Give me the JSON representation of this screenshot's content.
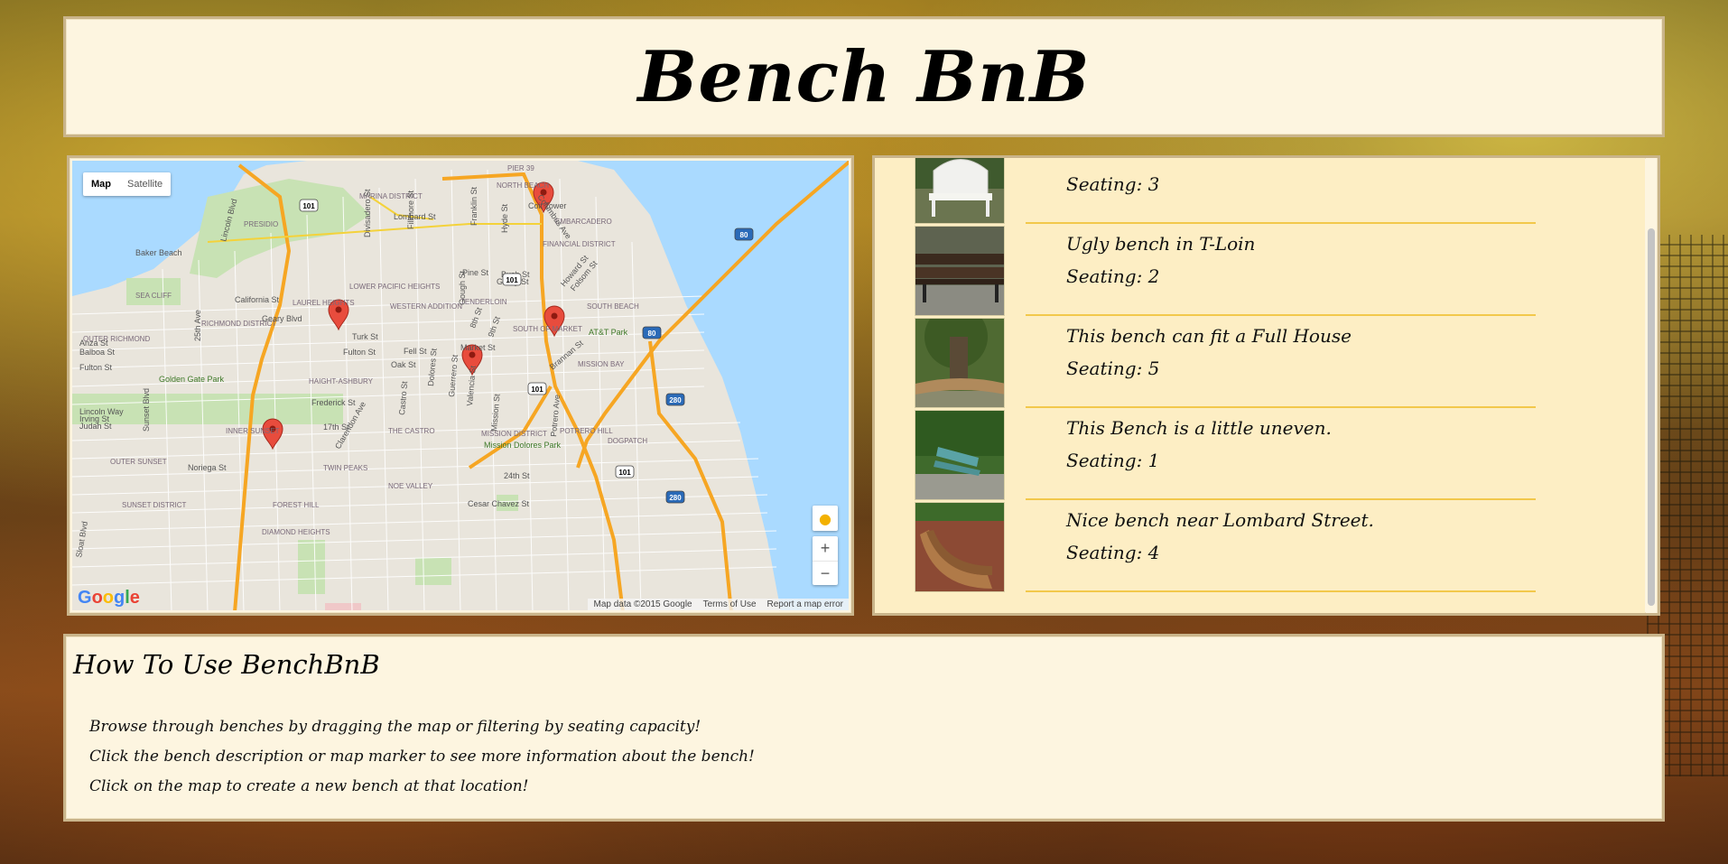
{
  "header": {
    "title": "Bench BnB"
  },
  "map": {
    "type_buttons": [
      {
        "label": "Map",
        "active": true
      },
      {
        "label": "Satellite",
        "active": false
      }
    ],
    "zoom_in": "+",
    "zoom_out": "−",
    "footer": {
      "attribution": "Map data ©2015 Google",
      "terms": "Terms of Use",
      "report": "Report a map error"
    },
    "logo": "Google",
    "place_labels": [
      "PIER 39",
      "NORTH BEACH",
      "MARINA DISTRICT",
      "Coit Tower",
      "Lombard St",
      "PRESIDIO",
      "EMBARCADERO",
      "FINANCIAL DISTRICT",
      "Baker Beach",
      "Pine St",
      "Bush St",
      "LOWER PACIFIC HEIGHTS",
      "California St",
      "LAUREL HEIGHTS",
      "SEA CLIFF",
      "TENDERLOIN",
      "SOUTH BEACH",
      "WESTERN ADDITION",
      "Turk St",
      "AT&T Park",
      "RICHMOND DISTRICT",
      "OUTER RICHMOND",
      "Geary Blvd",
      "Balboa St",
      "Fulton St",
      "Fell St",
      "Oak St",
      "SOUTH OF MARKET",
      "MISSION BAY",
      "Golden Gate Park",
      "HAIGHT-ASHBURY",
      "Lincoln Way",
      "Frederick St",
      "INNER SUNSET",
      "17th St",
      "THE CASTRO",
      "MISSION DISTRICT",
      "POTRERO HILL",
      "DOGPATCH",
      "Mission Dolores Park",
      "OUTER SUNSET",
      "Noriega St",
      "TWIN PEAKS",
      "NOE VALLEY",
      "24th St",
      "SUNSET DISTRICT",
      "FOREST HILL",
      "Cesar Chavez St",
      "DIAMOND HEIGHTS",
      "Judah St",
      "Irving St",
      "Anza St",
      "Fulton St",
      "Market St",
      "Divisadero St",
      "Fillmore St",
      "Franklin St",
      "Hyde St",
      "Gough St",
      "Columbus Ave",
      "Howard St",
      "Folsom St",
      "Brannan St",
      "Lincoln Blvd",
      "25th Ave",
      "Sunset Blvd",
      "Clarendon Ave",
      "Castro St",
      "Dolores St",
      "Guerrero St",
      "Valencia St",
      "Mission St",
      "Potrero Ave",
      "Sloat Blvd",
      "8th St",
      "9th St",
      "Geary St"
    ],
    "highway_shields": [
      "101",
      "101",
      "101",
      "80",
      "80",
      "280",
      "280",
      "101"
    ],
    "marker_count": 6
  },
  "benches": [
    {
      "title": "",
      "seating": "Seating: 3",
      "palette": "white-iron"
    },
    {
      "title": "Ugly bench in T-Loin",
      "seating": "Seating: 2",
      "palette": "dark-wood"
    },
    {
      "title": "This bench can fit a Full House",
      "seating": "Seating: 5",
      "palette": "tree-circle"
    },
    {
      "title": "This Bench is a little uneven.",
      "seating": "Seating: 1",
      "palette": "green-bench"
    },
    {
      "title": "Nice bench near Lombard Street.",
      "seating": "Seating: 4",
      "palette": "curved-brick"
    }
  ],
  "howto": {
    "heading": "How To Use BenchBnB",
    "lines": [
      "Browse through benches by dragging the map or filtering by seating capacity!",
      "Click the bench description or map marker to see more information about the bench!",
      "Click on the map to create a new bench at that location!"
    ]
  }
}
